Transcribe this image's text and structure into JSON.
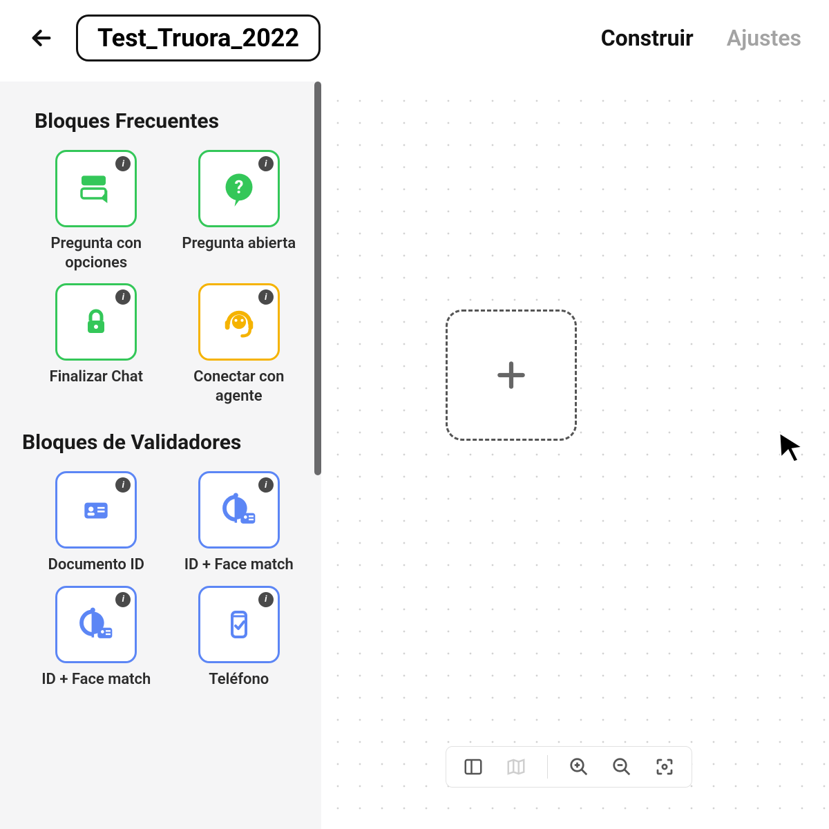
{
  "header": {
    "title": "Test_Truora_2022",
    "tabs": {
      "build": "Construir",
      "settings": "Ajustes"
    }
  },
  "sidebar": {
    "section_frequent": "Bloques Frecuentes",
    "section_validators": "Bloques de Validadores",
    "blocks_frequent": [
      {
        "label": "Pregunta con opciones",
        "icon": "form-select-icon",
        "color": "green"
      },
      {
        "label": "Pregunta abierta",
        "icon": "question-icon",
        "color": "green"
      },
      {
        "label": "Finalizar Chat",
        "icon": "lock-icon",
        "color": "green"
      },
      {
        "label": "Conectar con agente",
        "icon": "agent-icon",
        "color": "yellow"
      }
    ],
    "blocks_validators": [
      {
        "label": "Documento ID",
        "icon": "id-card-icon",
        "color": "blue"
      },
      {
        "label": "ID + Face match",
        "icon": "face-id-icon",
        "color": "blue"
      },
      {
        "label": "ID + Face match",
        "icon": "face-id-icon",
        "color": "blue"
      },
      {
        "label": "Teléfono",
        "icon": "phone-check-icon",
        "color": "blue"
      }
    ]
  },
  "colors": {
    "green": "#34c759",
    "yellow": "#f5b301",
    "blue": "#5c86f5"
  }
}
